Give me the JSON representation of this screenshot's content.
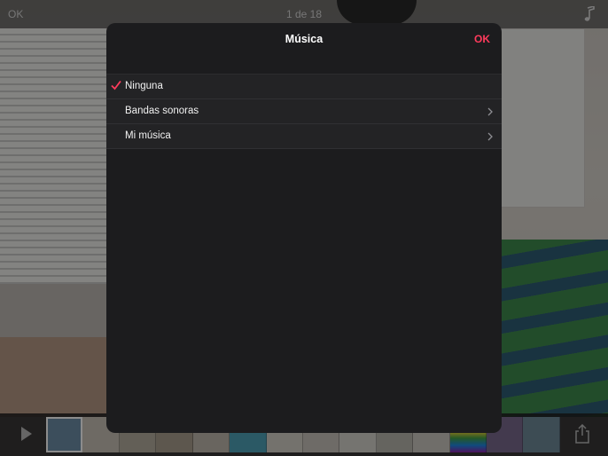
{
  "topbar": {
    "ok_label": "OK",
    "counter": "1 de 18"
  },
  "modal": {
    "title": "Música",
    "ok_label": "OK",
    "items": [
      {
        "label": "Ninguna",
        "selected": true,
        "has_chevron": false
      },
      {
        "label": "Bandas sonoras",
        "selected": false,
        "has_chevron": true
      },
      {
        "label": "Mi música",
        "selected": false,
        "has_chevron": true
      }
    ]
  },
  "colors": {
    "accent": "#ff3b5c",
    "modal_bg": "#1c1c1e",
    "row_bg": "#232325"
  },
  "icons": [
    "music-note-icon",
    "play-icon",
    "share-icon",
    "checkmark-icon",
    "chevron-right-icon"
  ]
}
